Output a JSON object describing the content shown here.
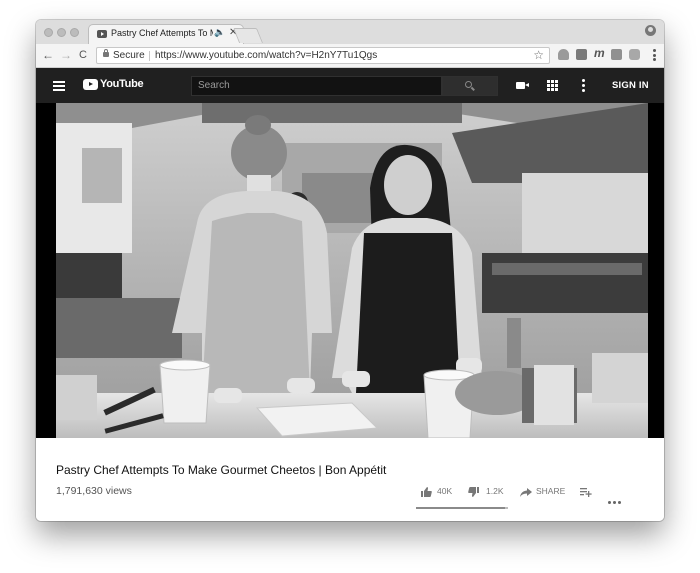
{
  "browser": {
    "tab_title": "Pastry Chef Attempts To Ma",
    "audio_glyph": "🔈",
    "close_glyph": "✕",
    "security_label": "Secure",
    "url": "https://www.youtube.com/watch?v=H2nY7Tu1Qgs",
    "nav": {
      "back": "←",
      "forward": "→",
      "reload": "C"
    },
    "star_glyph": "☆",
    "extension_m": "m"
  },
  "youtube": {
    "logo_text": "YouTube",
    "search_placeholder": "Search",
    "sign_in": "SIGN IN"
  },
  "video": {
    "title": "Pastry Chef Attempts To Make Gourmet Cheetos | Bon Appétit",
    "views": "1,791,630 views",
    "likes": "40K",
    "dislikes": "1.2K",
    "share_label": "SHARE",
    "like_ratio": 0.97
  },
  "colors": {
    "header_bg": "#202020",
    "player_bg": "#000000"
  },
  "icons": [
    "youtube-favicon-icon",
    "speaker-icon",
    "close-icon",
    "lock-icon",
    "star-icon",
    "hamburger-icon",
    "youtube-logo-icon",
    "search-icon",
    "upload-video-icon",
    "apps-icon",
    "more-vert-icon",
    "thumb-up-icon",
    "thumb-down-icon",
    "share-icon",
    "add-to-playlist-icon",
    "more-horiz-icon"
  ]
}
